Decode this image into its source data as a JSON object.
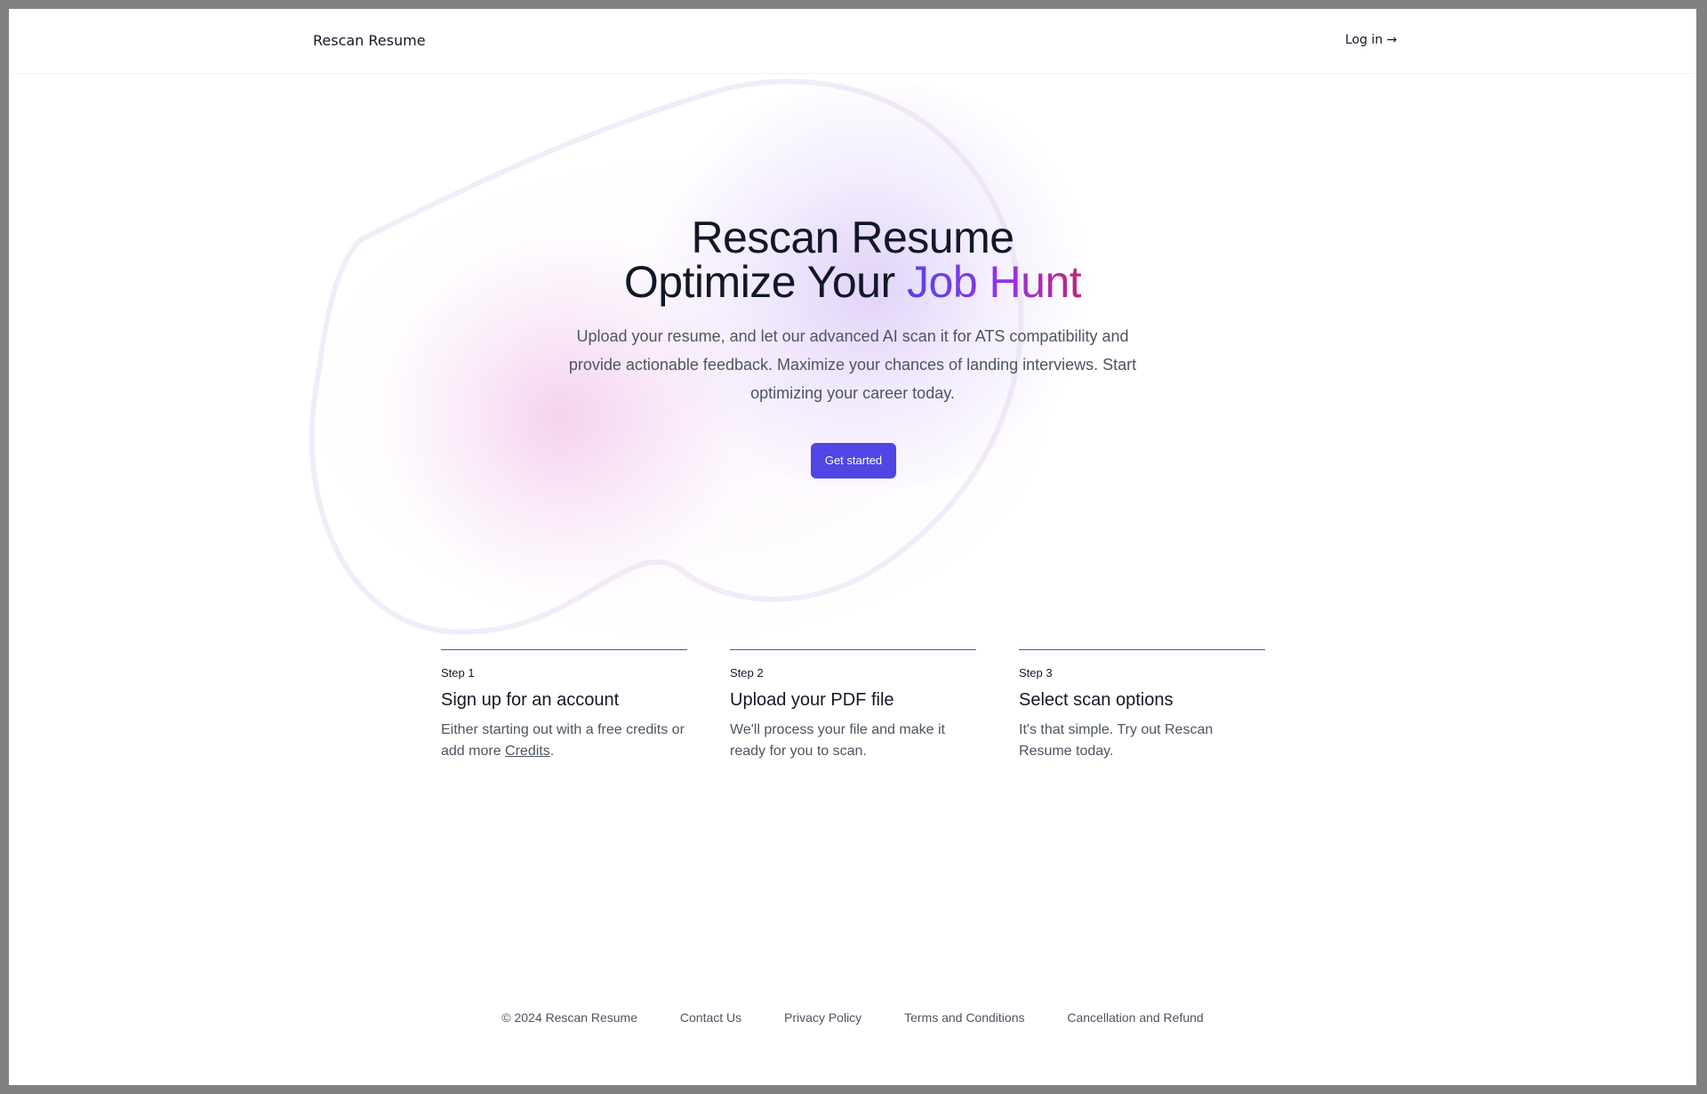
{
  "header": {
    "brand": "Rescan Resume",
    "login": "Log in →"
  },
  "hero": {
    "line1": "Rescan Resume",
    "line2_plain": "Optimize Your ",
    "line2_gradient": "Job Hunt",
    "description": "Upload your resume, and let our advanced AI scan it for ATS compatibility and provide actionable feedback. Maximize your chances of landing interviews. Start optimizing your career today.",
    "cta": "Get started"
  },
  "steps": [
    {
      "label": "Step 1",
      "title": "Sign up for an account",
      "desc_before": "Either starting out with a free credits or add more ",
      "desc_link": "Credits",
      "desc_after": "."
    },
    {
      "label": "Step 2",
      "title": "Upload your PDF file",
      "desc": "We'll process your file and make it ready for you to scan."
    },
    {
      "label": "Step 3",
      "title": "Select scan options",
      "desc": "It's that simple. Try out Rescan Resume today."
    }
  ],
  "footer": {
    "copyright": "© 2024 Rescan Resume",
    "links": [
      "Contact Us",
      "Privacy Policy",
      "Terms and Conditions",
      "Cancellation and Refund"
    ]
  },
  "colors": {
    "accent": "#4f46e5",
    "gradient_end": "#c0267a",
    "text": "#111827",
    "muted": "#4b5563"
  }
}
